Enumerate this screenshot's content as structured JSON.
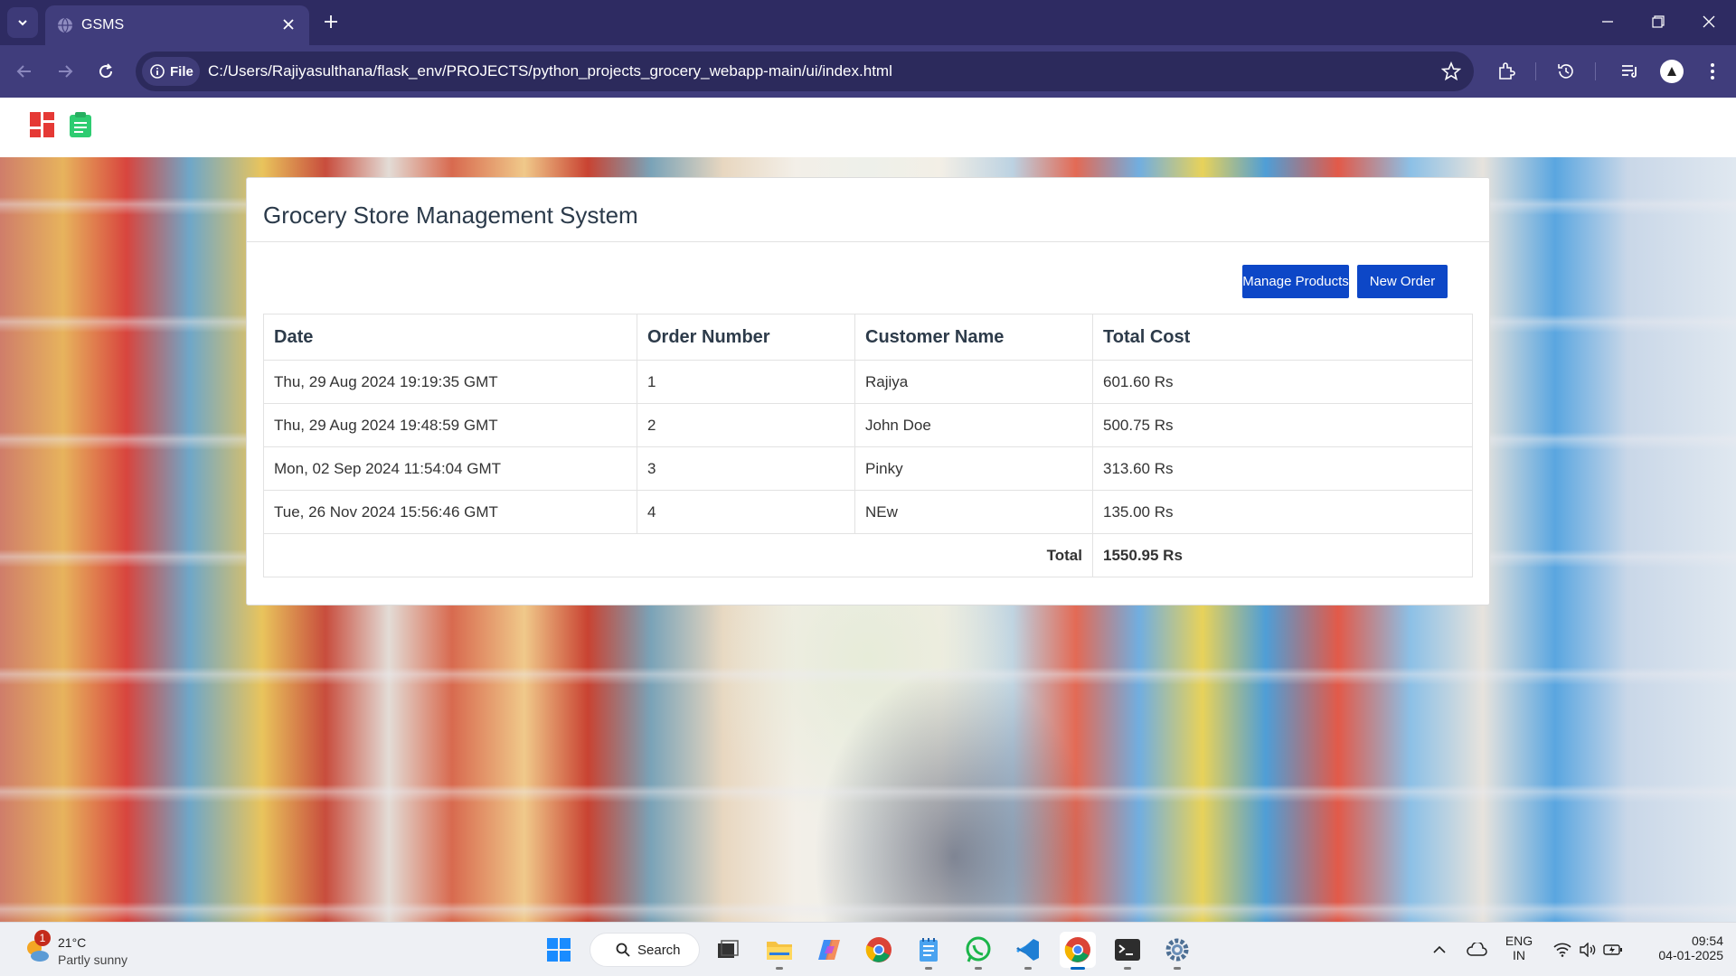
{
  "browser": {
    "tab_title": "GSMS",
    "file_chip": "File",
    "url": "C:/Users/Rajiyasulthana/flask_env/PROJECTS/python_projects_grocery_webapp-main/ui/index.html"
  },
  "panel": {
    "title": "Grocery Store Management System",
    "buttons": {
      "manage_products": "Manage Products",
      "new_order": "New Order"
    }
  },
  "table": {
    "headers": [
      "Date",
      "Order Number",
      "Customer Name",
      "Total Cost"
    ],
    "rows": [
      {
        "date": "Thu, 29 Aug 2024 19:19:35 GMT",
        "order_number": "1",
        "customer": "Rajiya",
        "total": "601.60 Rs"
      },
      {
        "date": "Thu, 29 Aug 2024 19:48:59 GMT",
        "order_number": "2",
        "customer": "John Doe",
        "total": "500.75 Rs"
      },
      {
        "date": "Mon, 02 Sep 2024 11:54:04 GMT",
        "order_number": "3",
        "customer": "Pinky",
        "total": "313.60 Rs"
      },
      {
        "date": "Tue, 26 Nov 2024 15:56:46 GMT",
        "order_number": "4",
        "customer": "NEw",
        "total": "135.00 Rs"
      }
    ],
    "total_label": "Total",
    "total_value": "1550.95 Rs"
  },
  "taskbar": {
    "weather": {
      "temp": "21°C",
      "condition": "Partly sunny",
      "badge": "1"
    },
    "search_label": "Search",
    "lang_top": "ENG",
    "lang_bottom": "IN",
    "time": "09:54",
    "date": "04-01-2025"
  },
  "colors": {
    "primary_button": "#0d47c7",
    "chrome_dark": "#2e2b62",
    "chrome_toolbar": "#403d7c",
    "logo_red": "#e53935",
    "logo_green": "#2ecc71"
  },
  "icons": {
    "nav_logo_1": "dashboard-icon",
    "nav_logo_2": "clipboard-icon"
  }
}
